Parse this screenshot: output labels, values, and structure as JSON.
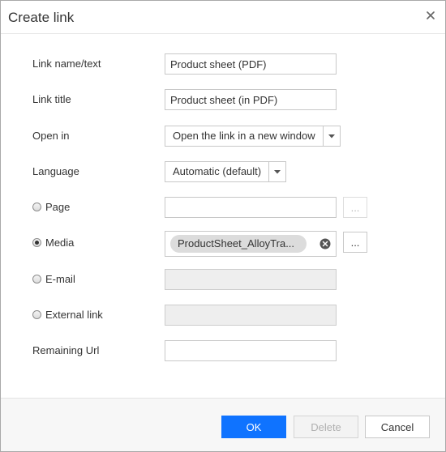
{
  "dialog": {
    "title": "Create link"
  },
  "form": {
    "link_name": {
      "label": "Link name/text",
      "value": "Product sheet (PDF)"
    },
    "link_title": {
      "label": "Link title",
      "value": "Product sheet (in PDF)"
    },
    "open_in": {
      "label": "Open in",
      "selected": "Open the link in a new window"
    },
    "language": {
      "label": "Language",
      "selected": "Automatic (default)"
    },
    "page": {
      "label": "Page",
      "value": "",
      "browse_label": "...",
      "checked": false
    },
    "media": {
      "label": "Media",
      "chip": "ProductSheet_AlloyTra...",
      "browse_label": "...",
      "checked": true
    },
    "email": {
      "label": "E-mail",
      "value": "",
      "checked": false
    },
    "external": {
      "label": "External link",
      "value": "",
      "checked": false
    },
    "remaining": {
      "label": "Remaining Url",
      "value": ""
    }
  },
  "footer": {
    "ok_label": "OK",
    "delete_label": "Delete",
    "cancel_label": "Cancel"
  },
  "colors": {
    "primary": "#0f73ff",
    "chip_bg": "#dcdcdc",
    "disabled_bg": "#eeeeee"
  },
  "icons": {
    "close": "close-icon",
    "dropdown": "caret-down-icon",
    "remove": "remove-circle-icon"
  }
}
